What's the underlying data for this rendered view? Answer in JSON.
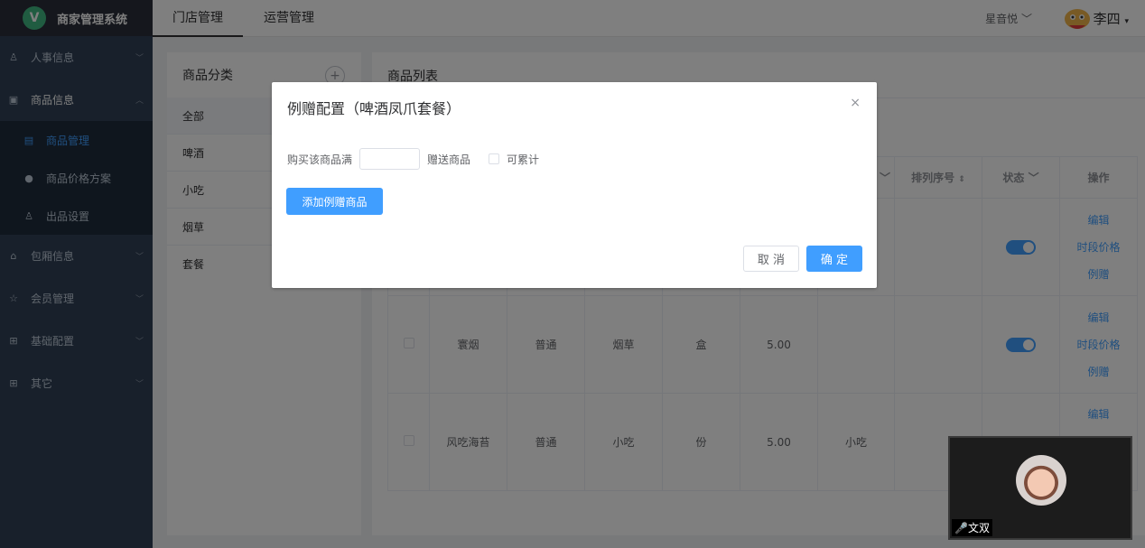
{
  "app": {
    "title": "商家管理系统",
    "logo_letter": "V"
  },
  "sidebar": {
    "items": [
      {
        "label": "人事信息",
        "icon": "person-icon"
      },
      {
        "label": "商品信息",
        "icon": "square-icon"
      },
      {
        "label": "包厢信息",
        "icon": "home-icon"
      },
      {
        "label": "会员管理",
        "icon": "star-icon"
      },
      {
        "label": "基础配置",
        "icon": "grid-icon"
      },
      {
        "label": "其它",
        "icon": "grid-icon"
      }
    ],
    "sub_items": [
      {
        "label": "商品管理",
        "active": true
      },
      {
        "label": "商品价格方案",
        "active": false
      },
      {
        "label": "出品设置",
        "active": false
      }
    ]
  },
  "header": {
    "tabs": [
      "门店管理",
      "运营管理"
    ],
    "store": "星音悦",
    "user": "李四"
  },
  "category": {
    "title": "商品分类",
    "items": [
      "全部",
      "啤酒",
      "小吃",
      "烟草",
      "套餐"
    ]
  },
  "list": {
    "title": "商品列表",
    "columns": {
      "sort": "排列序号",
      "status": "状态",
      "ops": "操作"
    },
    "rows": [
      {
        "name": "",
        "type": "",
        "category": "",
        "unit": "",
        "price": "",
        "extra": "",
        "status_on": true
      },
      {
        "name": "寰烟",
        "type": "普通",
        "category": "烟草",
        "unit": "盒",
        "price": "5.00",
        "extra": "",
        "status_on": true
      },
      {
        "name": "风吃海苔",
        "type": "普通",
        "category": "小吃",
        "unit": "份",
        "price": "5.00",
        "extra": "小吃",
        "status_on": false
      }
    ],
    "ops": {
      "edit": "编辑",
      "period_price": "时段价格",
      "gift": "例赠"
    }
  },
  "dialog": {
    "title": "例赠配置（啤酒凤爪套餐）",
    "buy_label": "购买该商品满",
    "gift_label": "赠送商品",
    "cumulative_label": "可累计",
    "add_button": "添加例赠商品",
    "cancel": "取 消",
    "ok": "确 定",
    "close": "×"
  },
  "video": {
    "name": "文双"
  }
}
